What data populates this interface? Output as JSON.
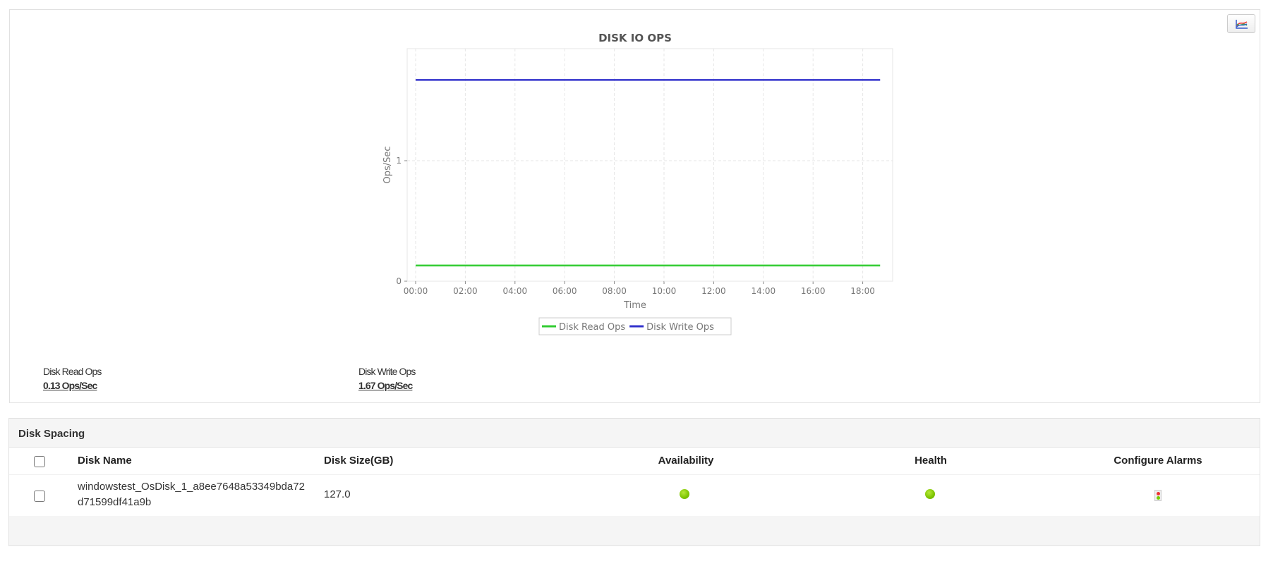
{
  "chart_panel": {
    "chart_type_button_icon": "line-chart-icon",
    "stats": [
      {
        "label": "Disk Read Ops",
        "value": "0.13 Ops/Sec"
      },
      {
        "label": "Disk Write Ops",
        "value": "1.67 Ops/Sec"
      }
    ]
  },
  "chart_data": {
    "type": "line",
    "title": "DISK IO OPS",
    "xlabel": "Time",
    "ylabel": "Ops/Sec",
    "x_ticks": [
      "00:00",
      "02:00",
      "04:00",
      "06:00",
      "08:00",
      "10:00",
      "12:00",
      "14:00",
      "16:00",
      "18:00"
    ],
    "y_ticks": [
      "0",
      "1"
    ],
    "xlim_hours": [
      0,
      18.7
    ],
    "ylim": [
      0,
      1.93
    ],
    "grid": true,
    "legend_position": "bottom",
    "series": [
      {
        "name": "Disk Read Ops",
        "color": "#33cc33",
        "x_hours": [
          0,
          18.7
        ],
        "values": [
          0.13,
          0.13
        ]
      },
      {
        "name": "Disk Write Ops",
        "color": "#3333cc",
        "x_hours": [
          0,
          18.7
        ],
        "values": [
          1.67,
          1.67
        ]
      }
    ]
  },
  "table": {
    "title": "Disk Spacing",
    "columns": [
      "Disk Name",
      "Disk Size(GB)",
      "Availability",
      "Health",
      "Configure Alarms"
    ],
    "rows": [
      {
        "name_line1": "windowstest_OsDisk_1_a8ee7648a53349bda72",
        "name_line2": "d71599df41a9b",
        "size": "127.0",
        "availability": "up",
        "health": "clear",
        "alarm_icon": "traffic-light-icon"
      }
    ],
    "status_color": "#7cc400"
  }
}
